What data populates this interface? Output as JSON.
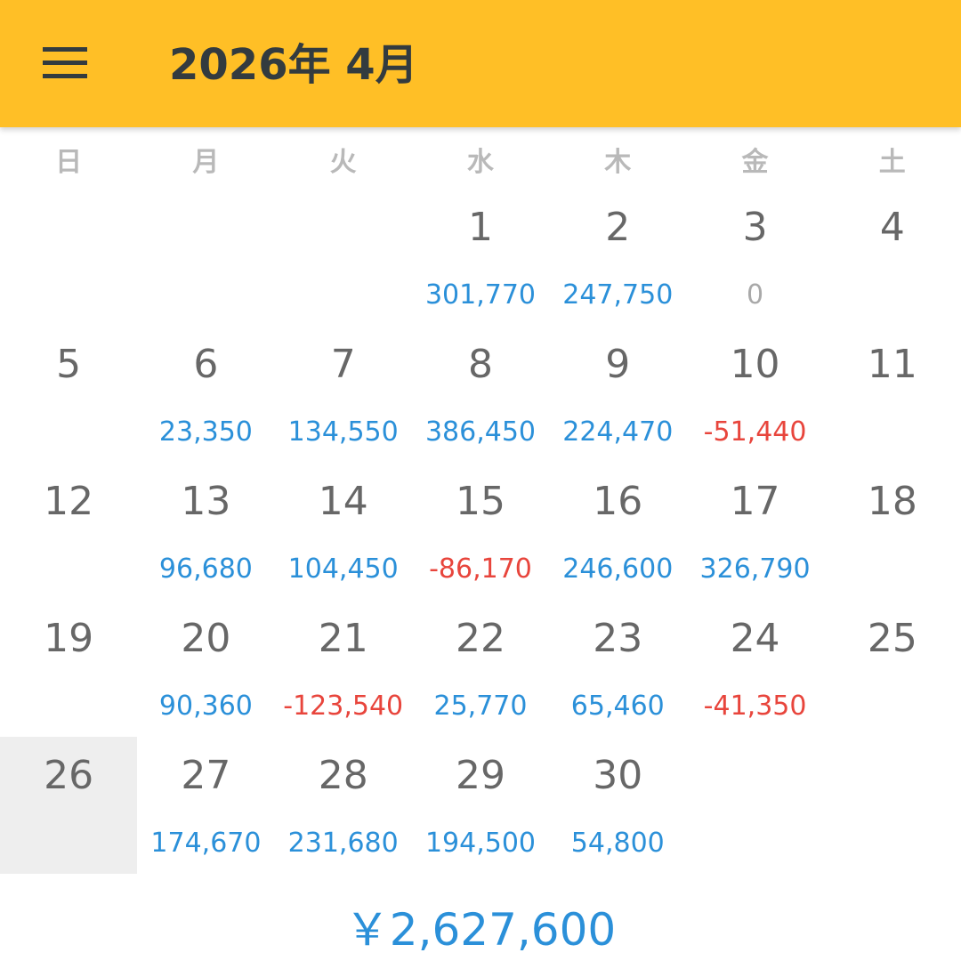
{
  "header": {
    "title": "2026年 4月",
    "menu_icon": "hamburger-menu-icon"
  },
  "weekdays": [
    "日",
    "月",
    "火",
    "水",
    "木",
    "金",
    "土"
  ],
  "calendar": {
    "first_weekday_index": 3,
    "selected_day": 26,
    "days": [
      {
        "day": "1",
        "amount": "301,770",
        "sign": "pos"
      },
      {
        "day": "2",
        "amount": "247,750",
        "sign": "pos"
      },
      {
        "day": "3",
        "amount": "0",
        "sign": "zero"
      },
      {
        "day": "4",
        "amount": "",
        "sign": ""
      },
      {
        "day": "5",
        "amount": "",
        "sign": ""
      },
      {
        "day": "6",
        "amount": "23,350",
        "sign": "pos"
      },
      {
        "day": "7",
        "amount": "134,550",
        "sign": "pos"
      },
      {
        "day": "8",
        "amount": "386,450",
        "sign": "pos"
      },
      {
        "day": "9",
        "amount": "224,470",
        "sign": "pos"
      },
      {
        "day": "10",
        "amount": "-51,440",
        "sign": "neg"
      },
      {
        "day": "11",
        "amount": "",
        "sign": ""
      },
      {
        "day": "12",
        "amount": "",
        "sign": ""
      },
      {
        "day": "13",
        "amount": "96,680",
        "sign": "pos"
      },
      {
        "day": "14",
        "amount": "104,450",
        "sign": "pos"
      },
      {
        "day": "15",
        "amount": "-86,170",
        "sign": "neg"
      },
      {
        "day": "16",
        "amount": "246,600",
        "sign": "pos"
      },
      {
        "day": "17",
        "amount": "326,790",
        "sign": "pos"
      },
      {
        "day": "18",
        "amount": "",
        "sign": ""
      },
      {
        "day": "19",
        "amount": "",
        "sign": ""
      },
      {
        "day": "20",
        "amount": "90,360",
        "sign": "pos"
      },
      {
        "day": "21",
        "amount": "-123,540",
        "sign": "neg"
      },
      {
        "day": "22",
        "amount": "25,770",
        "sign": "pos"
      },
      {
        "day": "23",
        "amount": "65,460",
        "sign": "pos"
      },
      {
        "day": "24",
        "amount": "-41,350",
        "sign": "neg"
      },
      {
        "day": "25",
        "amount": "",
        "sign": ""
      },
      {
        "day": "26",
        "amount": "",
        "sign": ""
      },
      {
        "day": "27",
        "amount": "174,670",
        "sign": "pos"
      },
      {
        "day": "28",
        "amount": "231,680",
        "sign": "pos"
      },
      {
        "day": "29",
        "amount": "194,500",
        "sign": "pos"
      },
      {
        "day": "30",
        "amount": "54,800",
        "sign": "pos"
      }
    ]
  },
  "summary": {
    "total": "￥2,627,600"
  },
  "colors": {
    "appbar": "#FFBF26",
    "positive": "#2B90D9",
    "negative": "#E8453C",
    "zero": "#A9A9A9",
    "selected_cell": "#EEEEEE"
  }
}
